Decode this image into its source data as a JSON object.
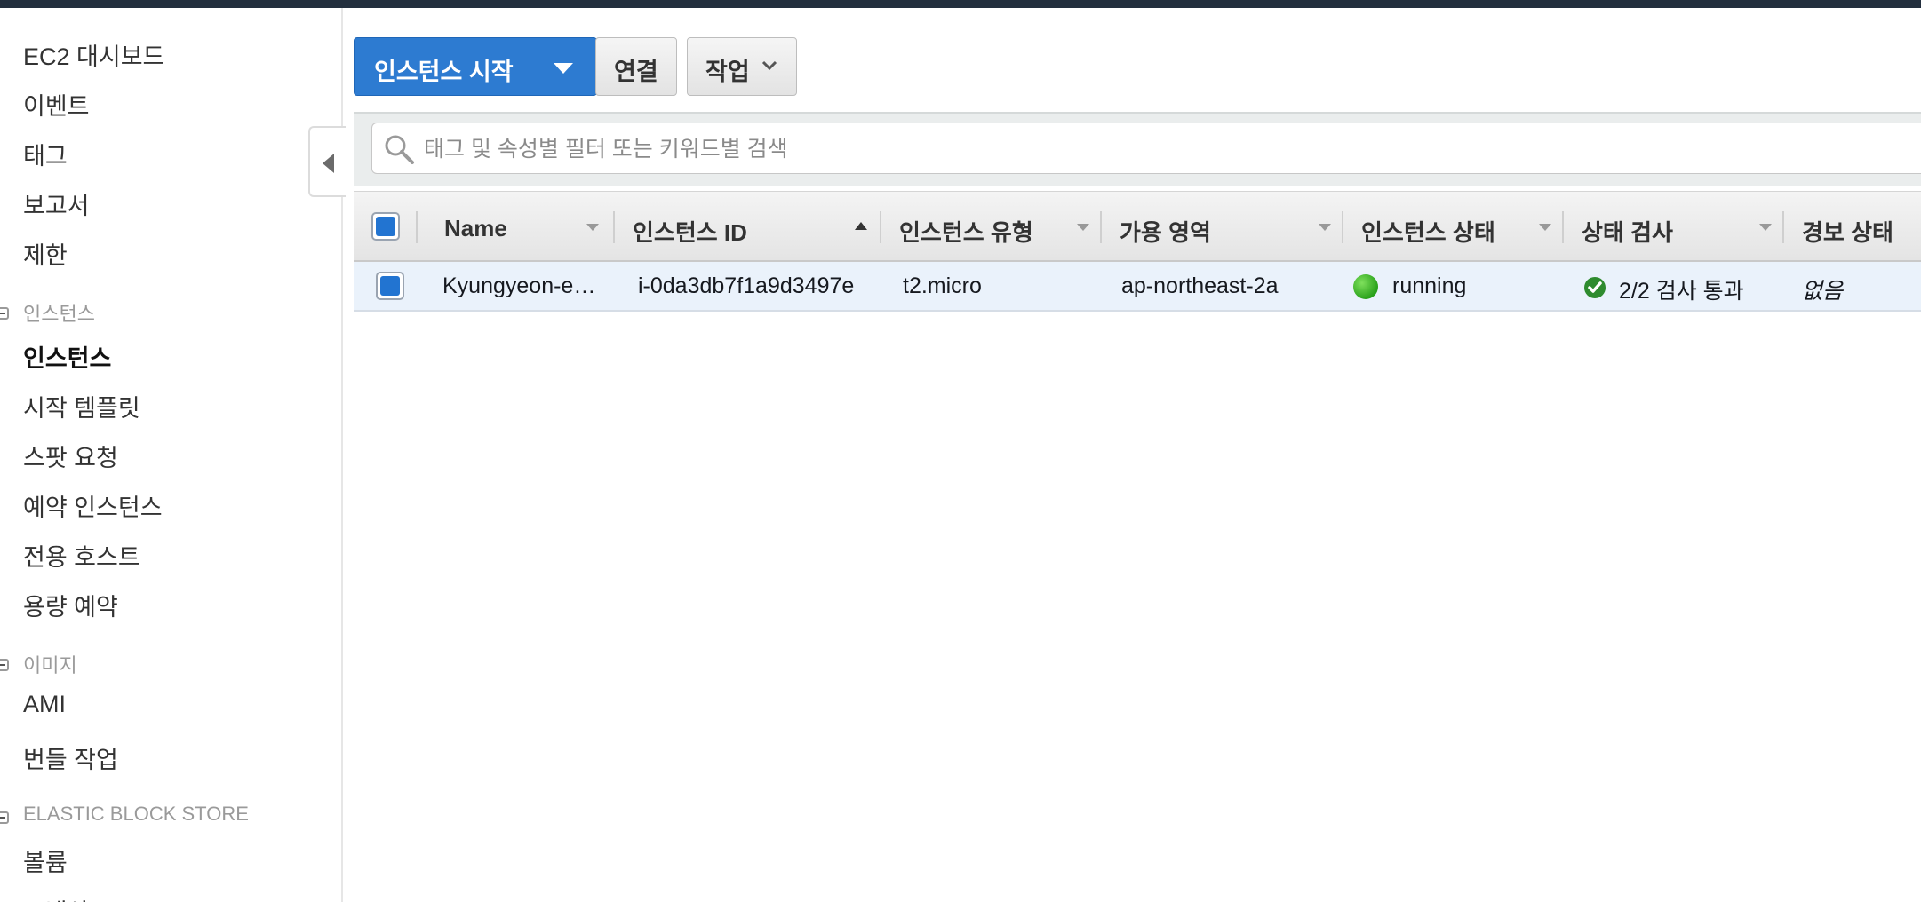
{
  "sidebar": {
    "items_top": [
      "EC2 대시보드",
      "이벤트",
      "태그",
      "보고서",
      "제한"
    ],
    "section_instances": "인스턴스",
    "items_instances": [
      "인스턴스",
      "시작 템플릿",
      "스팟 요청",
      "예약 인스턴스",
      "전용 호스트",
      "용량 예약"
    ],
    "section_images": "이미지",
    "items_images": [
      "AMI",
      "번들 작업"
    ],
    "section_ebs": "ELASTIC BLOCK STORE",
    "items_ebs": [
      "볼륨",
      "스냅샷"
    ],
    "active_item": "인스턴스"
  },
  "toolbar": {
    "launch_label": "인스턴스 시작",
    "connect_label": "연결",
    "actions_label": "작업"
  },
  "search": {
    "placeholder": "태그 및 속성별 필터 또는 키워드별 검색",
    "value": ""
  },
  "table": {
    "columns": [
      "Name",
      "인스턴스 ID",
      "인스턴스 유형",
      "가용 영역",
      "인스턴스 상태",
      "상태 검사",
      "경보 상태"
    ],
    "sorted_column": "인스턴스 ID",
    "rows": [
      {
        "name": "Kyungyeon-e…",
        "instance_id": "i-0da3db7f1a9d3497e",
        "instance_type": "t2.micro",
        "availability_zone": "ap-northeast-2a",
        "instance_state": "running",
        "status_check": "2/2 검사 통과",
        "alarm_status": "없음"
      }
    ]
  },
  "colors": {
    "primary_button": "#2d7bd1",
    "running_status": "#2aa21b",
    "selected_row": "#eaf2fb",
    "topbar": "#232f3e"
  },
  "icons": [
    "collapse-left-icon",
    "search-icon",
    "chevron-down-icon",
    "sort-asc-icon",
    "status-running-icon",
    "check-circle-icon"
  ]
}
